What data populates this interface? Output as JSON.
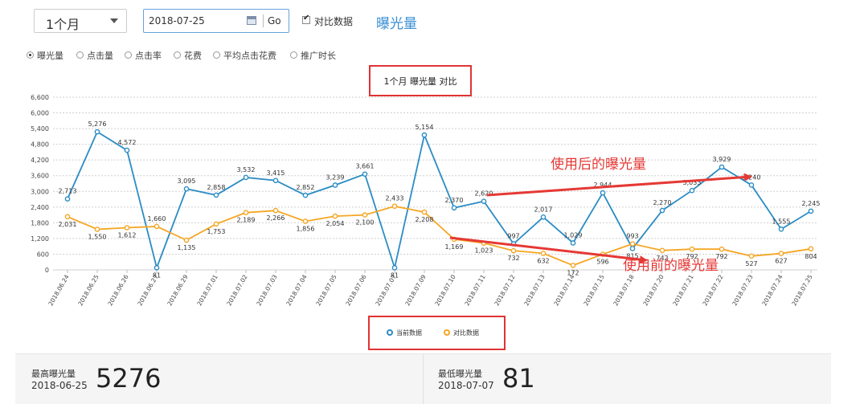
{
  "toolbar": {
    "period": "1个月",
    "date": "2018-07-25",
    "go_label": "Go",
    "compare_label": "对比数据",
    "compare_checked": true,
    "metric_title": "曝光量"
  },
  "metrics": [
    {
      "label": "曝光量",
      "selected": true
    },
    {
      "label": "点击量",
      "selected": false
    },
    {
      "label": "点击率",
      "selected": false
    },
    {
      "label": "花费",
      "selected": false
    },
    {
      "label": "平均点击花费",
      "selected": false
    },
    {
      "label": "推广时长",
      "selected": false
    }
  ],
  "chart_data": {
    "type": "line",
    "title": "1个月  曝光量  对比",
    "categories": [
      "2018.06.24",
      "2018.06.25",
      "2018.06.26",
      "2018.06.27",
      "2018.06.29",
      "2018.07.01",
      "2018.07.02",
      "2018.07.03",
      "2018.07.04",
      "2018.07.05",
      "2018.07.06",
      "2018.07.07",
      "2018.07.09",
      "2018.07.10",
      "2018.07.11",
      "2018.07.12",
      "2018.07.13",
      "2018.07.14",
      "2018.07.15",
      "2018.07.18",
      "2018.07.20",
      "2018.07.21",
      "2018.07.22",
      "2018.07.23",
      "2018.07.24",
      "2018.07.25"
    ],
    "series": [
      {
        "name": "当前数据",
        "color": "#2b8cc4",
        "values": [
          2713,
          5276,
          4572,
          81,
          3095,
          2858,
          3532,
          3415,
          2852,
          3239,
          3661,
          81,
          5154,
          2370,
          2620,
          997,
          2017,
          1029,
          2944,
          815,
          2270,
          3033,
          3929,
          3240,
          1555,
          2245
        ]
      },
      {
        "name": "对比数据",
        "color": "#f5a623",
        "values": [
          2031,
          1550,
          1612,
          1660,
          1135,
          1753,
          2189,
          2266,
          1856,
          2054,
          2100,
          2433,
          2208,
          1169,
          1023,
          732,
          632,
          172,
          596,
          993,
          742,
          792,
          792,
          527,
          627,
          804
        ]
      }
    ],
    "value_labels": {
      "当前数据": [
        "2,713",
        "5,276",
        "4,572",
        "81",
        "3,095",
        "2,858",
        "3,532",
        "3,415",
        "2,852",
        "3,239",
        "3,661",
        "81",
        "5,154",
        "2,370",
        "2,620",
        "997",
        "2,017",
        "1,029",
        "2,944",
        "815",
        "2,270",
        "3,033",
        "3,929",
        "3,240",
        "1,555",
        "2,245"
      ],
      "对比数据": [
        "2,031",
        "1,550",
        "1,612",
        "1,660",
        "1,135",
        "1,753",
        "2,189",
        "2,266",
        "1,856",
        "2,054",
        "2,100",
        "2,433",
        "2,208",
        "1,169",
        "1,023",
        "732",
        "632",
        "172",
        "596",
        "993",
        "742",
        "792",
        "792",
        "527",
        "627",
        "804"
      ]
    },
    "y_ticks": [
      "0",
      "600",
      "1,200",
      "1,800",
      "2,400",
      "3,000",
      "3,600",
      "4,200",
      "4,800",
      "5,400",
      "6,000",
      "6,600"
    ],
    "ylim": [
      0,
      6600
    ],
    "grid": true,
    "legend_position": "bottom-center",
    "annotations": {
      "after": "使用后的曝光量",
      "before": "使用前的曝光量"
    },
    "annotation_color": "#e53935"
  },
  "legend": [
    {
      "label": "当前数据",
      "color": "#2b8cc4"
    },
    {
      "label": "对比数据",
      "color": "#f5a623"
    }
  ],
  "stats": {
    "max": {
      "label": "最高曝光量",
      "date": "2018-06-25",
      "value": "5276"
    },
    "min": {
      "label": "最低曝光量",
      "date": "2018-07-07",
      "value": "81"
    }
  }
}
